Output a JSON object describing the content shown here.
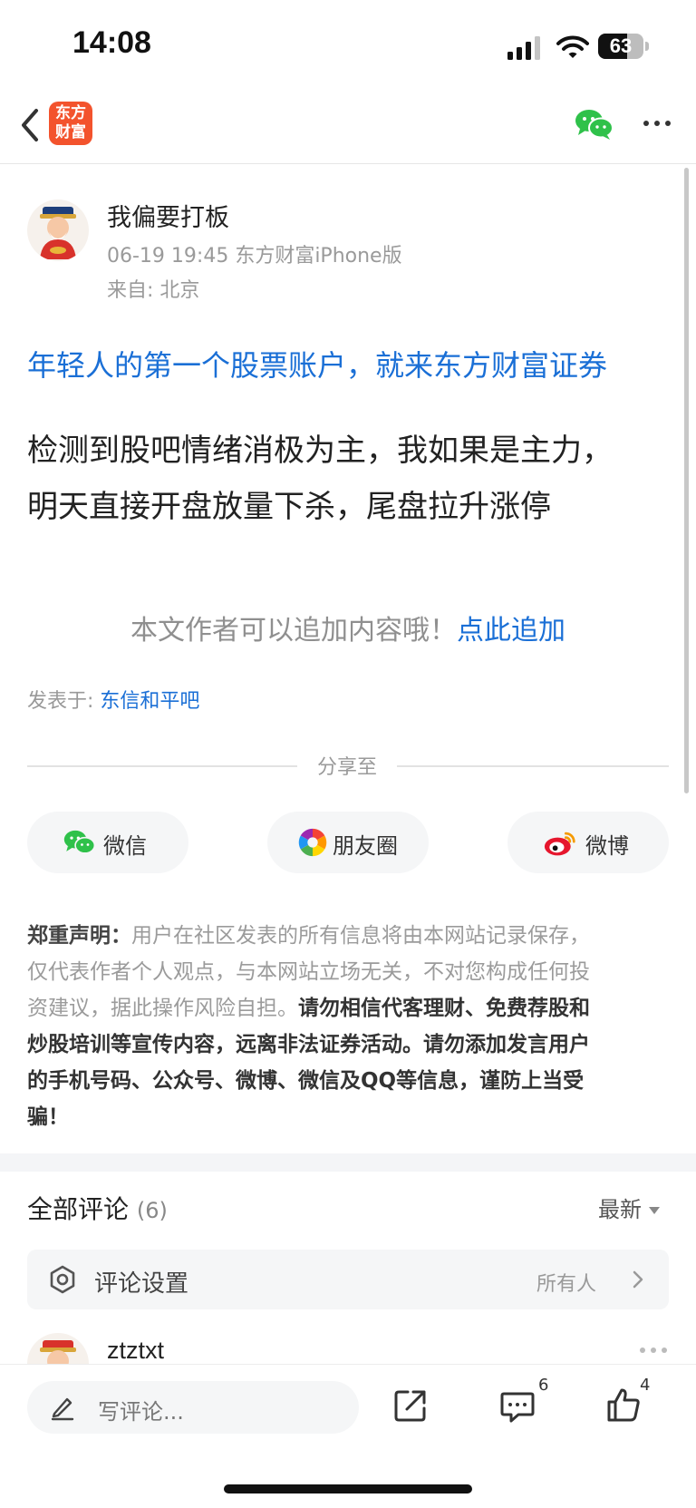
{
  "status_bar": {
    "time": "14:08",
    "battery": "63",
    "battery_level": 0.63
  },
  "nav": {
    "logo_line1": "东方",
    "logo_line2": "财富",
    "icons": [
      "back-icon",
      "wechat-icon",
      "more-icon"
    ]
  },
  "post": {
    "author": "我偏要打板",
    "meta": "06-19 19:45 东方财富iPhone版",
    "location": "来自: 北京",
    "promo": "年轻人的第一个股票账户，就来东方财富证券",
    "body_lines": [
      "检测到股吧情绪消极为主，我如果是主力，",
      "明天直接开盘放量下杀，尾盘拉升涨停"
    ],
    "append_prompt": "本文作者可以追加内容哦！",
    "append_link": "点此追加",
    "posted_label": "发表于: ",
    "posted_bar": "东信和平吧"
  },
  "share": {
    "label": "分享至",
    "buttons": [
      {
        "label": "微信",
        "icon": "wechat-icon"
      },
      {
        "label": "朋友圈",
        "icon": "moments-icon"
      },
      {
        "label": "微博",
        "icon": "weibo-icon"
      }
    ]
  },
  "disclaimer": {
    "title": "郑重声明：",
    "line1_rest": "用户在社区发表的所有信息将由本网站记录保存，",
    "line2": "仅代表作者个人观点，与本网站立场无关，不对您构成任何投",
    "line3_normal": "资建议，据此操作风险自担。",
    "line3_bold": "请勿相信代客理财、免费荐股和",
    "line4": "炒股培训等宣传内容，远离非法证券活动。请勿添加发言用户",
    "line5": "的手机号码、公众号、微博、微信及QQ等信息，谨防上当受",
    "line6": "骗！"
  },
  "comments": {
    "title": "全部评论",
    "count": "(6)",
    "sort": "最新",
    "settings_label": "评论设置",
    "settings_value": "所有人",
    "first_user": "ztztxt"
  },
  "bottom_bar": {
    "placeholder": "写评论...",
    "comment_count": "6",
    "like_count": "4"
  },
  "colors": {
    "link": "#1a6fd6",
    "brand": "#f3532d",
    "wechat": "#2fc14a"
  }
}
